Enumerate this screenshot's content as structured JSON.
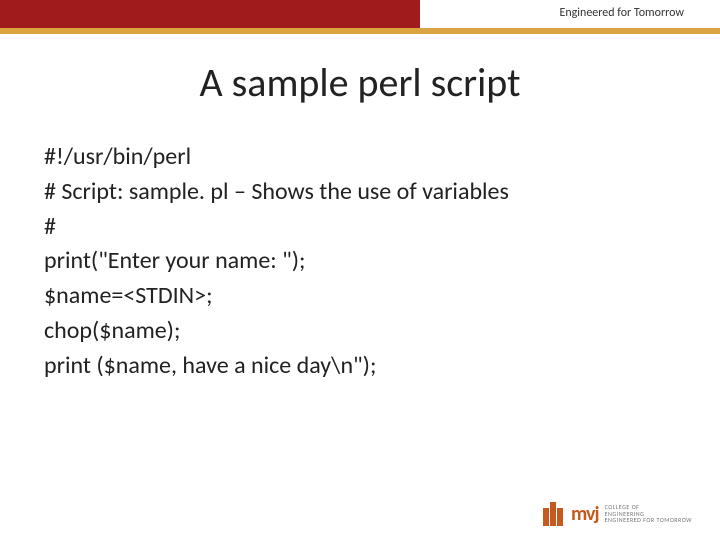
{
  "header": {
    "tagline": "Engineered for Tomorrow"
  },
  "title": "A sample perl script",
  "code": {
    "l1": "#!/usr/bin/perl",
    "l2": "# Script: sample. pl – Shows the use of variables",
    "l3": "#",
    "l4": "print(\"Enter your name: \");",
    "l5": "$name=<STDIN>;",
    "l6": "chop($name);",
    "l7": "print ($name, have a nice day\\n\");"
  },
  "logo": {
    "mark": "mvj",
    "t1": "COLLEGE OF",
    "t2": "ENGINEERING",
    "t3": "ENGINEERED FOR TOMORROW"
  }
}
